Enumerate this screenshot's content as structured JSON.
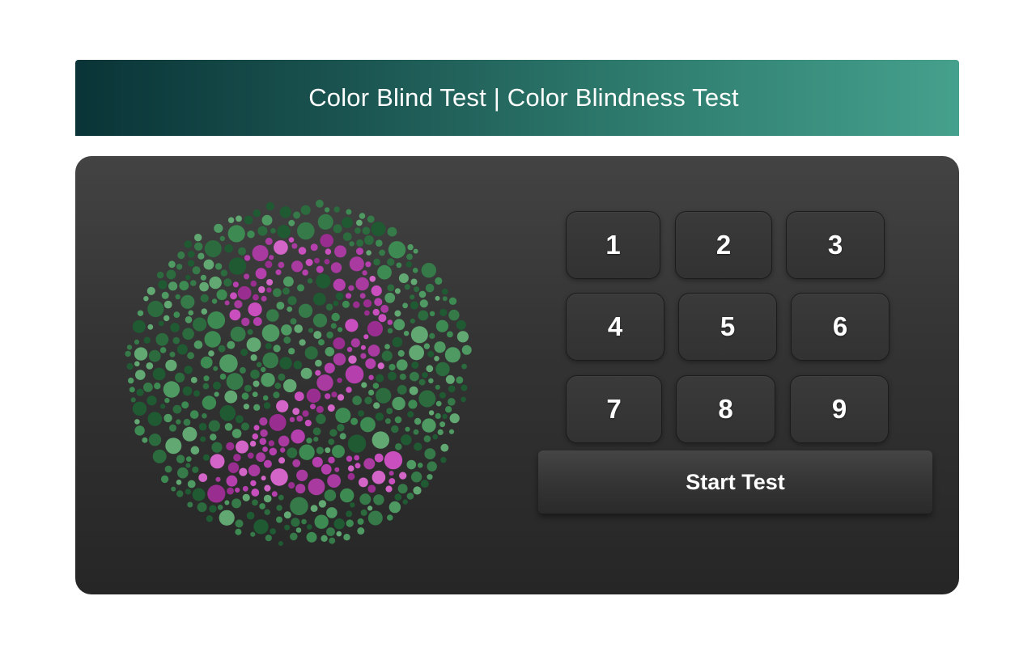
{
  "header": {
    "title": "Color Blind Test | Color Blindness Test"
  },
  "plate": {
    "digit": "2",
    "background_colors": [
      "#2b6b3e",
      "#3d8a52",
      "#4f9a62",
      "#62a872",
      "#1f5a33",
      "#357a48"
    ],
    "figure_colors": [
      "#b63fae",
      "#c94fbe",
      "#9a2e90",
      "#d465c8",
      "#a83aa0"
    ]
  },
  "keypad": {
    "buttons": [
      "1",
      "2",
      "3",
      "4",
      "5",
      "6",
      "7",
      "8",
      "9"
    ]
  },
  "start_button": {
    "label": "Start Test"
  }
}
